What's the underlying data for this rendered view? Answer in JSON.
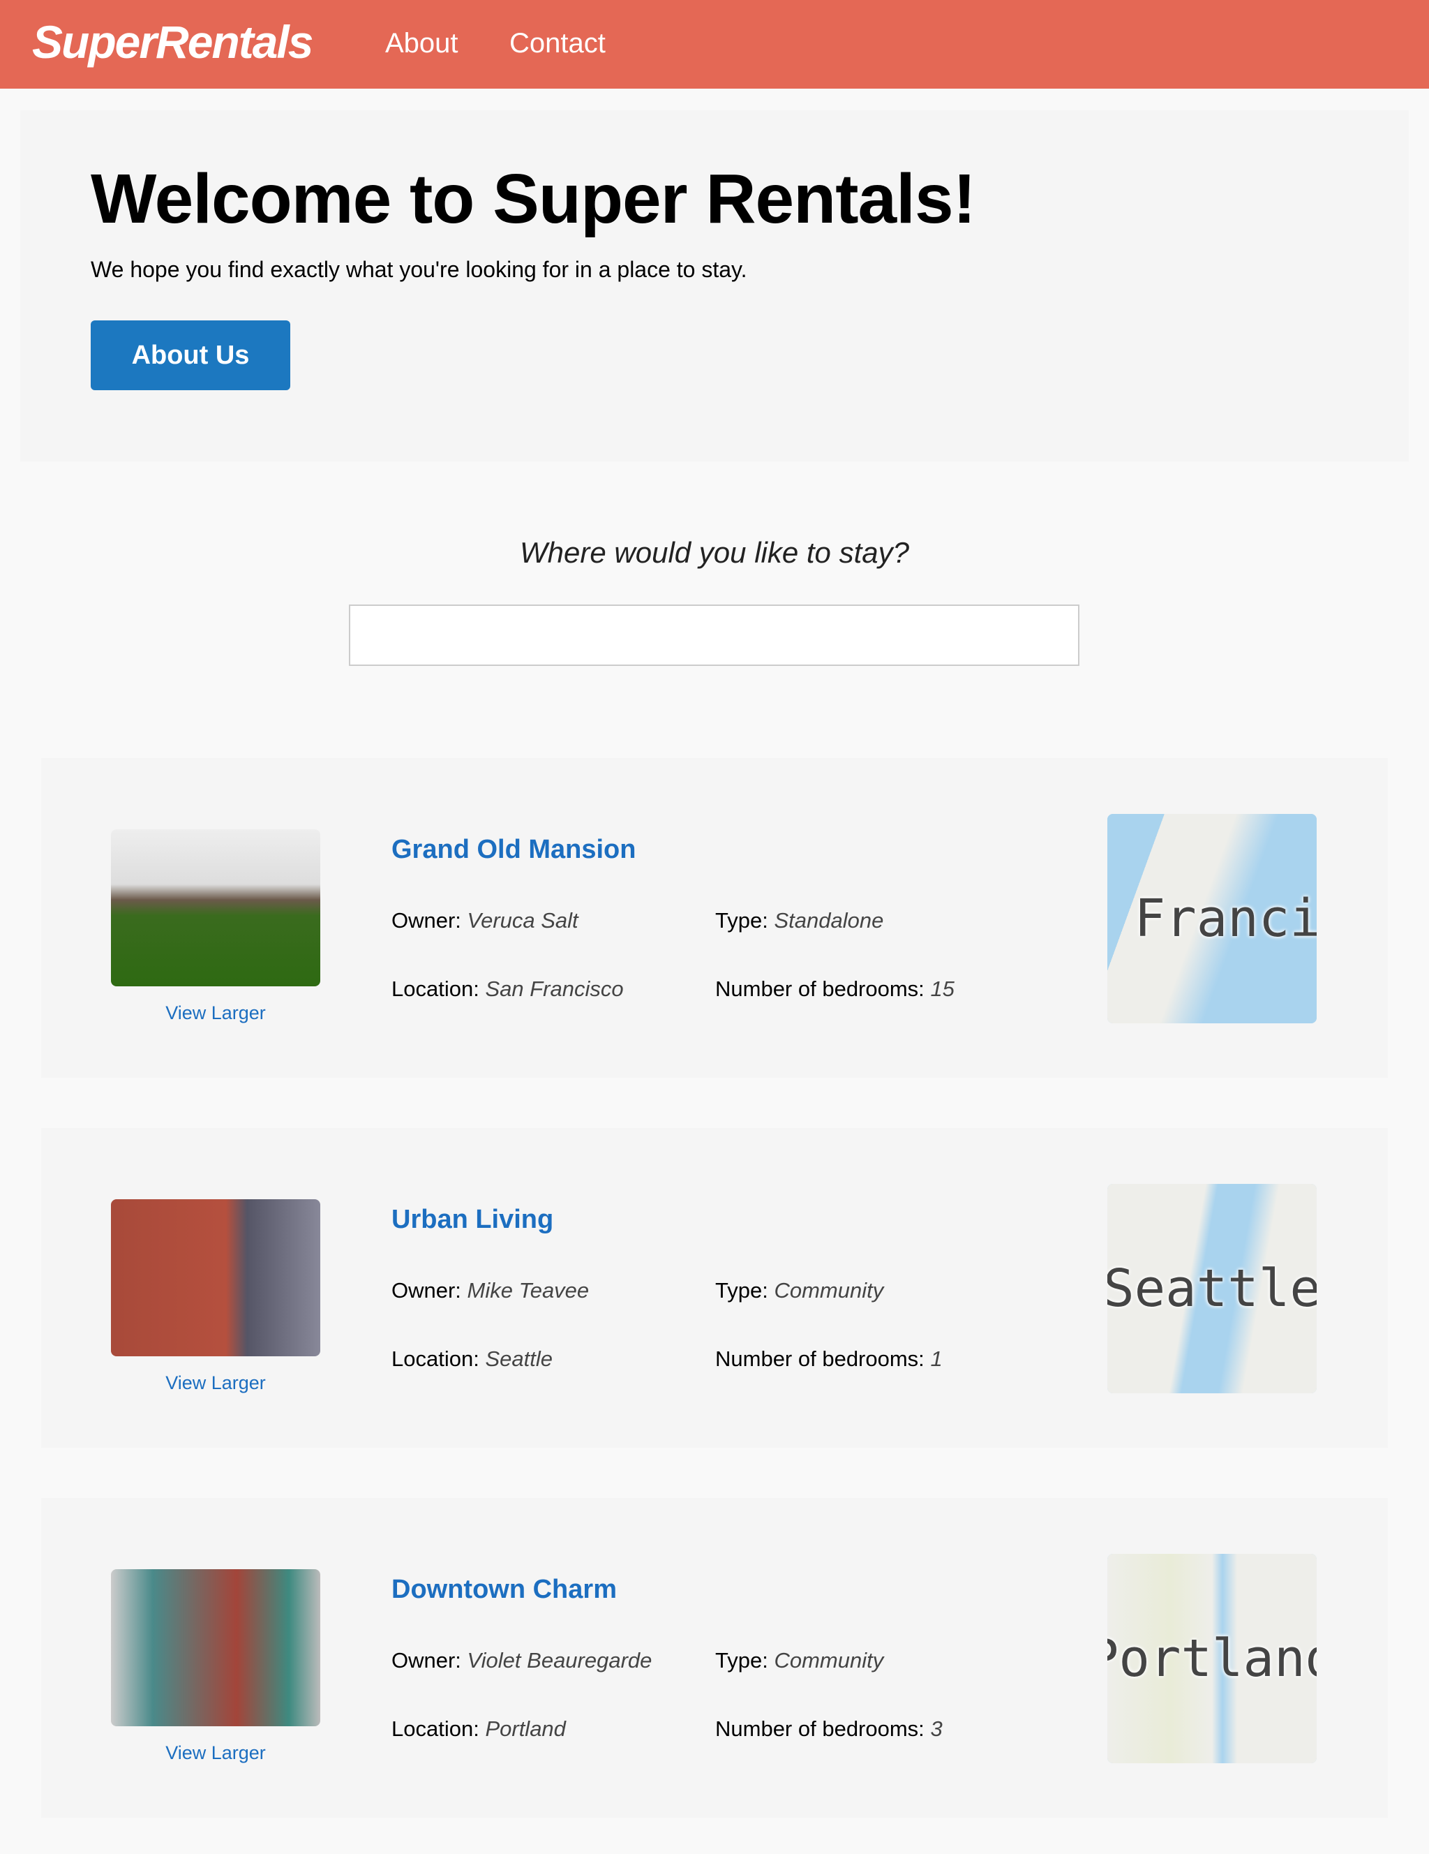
{
  "header": {
    "logo": "SuperRentals",
    "nav": [
      "About",
      "Contact"
    ]
  },
  "jumbo": {
    "title": "Welcome to Super Rentals!",
    "subtitle": "We hope you find exactly what you're looking for in a place to stay.",
    "button": "About Us"
  },
  "search": {
    "prompt": "Where would you like to stay?",
    "value": ""
  },
  "labels": {
    "owner": "Owner:",
    "type": "Type:",
    "location": "Location:",
    "bedrooms": "Number of bedrooms:",
    "view_larger": "View Larger"
  },
  "rentals": [
    {
      "title": "Grand Old Mansion",
      "owner": "Veruca Salt",
      "type": "Standalone",
      "location": "San Francisco",
      "bedrooms": "15",
      "map_label": "n Francis"
    },
    {
      "title": "Urban Living",
      "owner": "Mike Teavee",
      "type": "Community",
      "location": "Seattle",
      "bedrooms": "1",
      "map_label": "Seattle"
    },
    {
      "title": "Downtown Charm",
      "owner": "Violet Beauregarde",
      "type": "Community",
      "location": "Portland",
      "bedrooms": "3",
      "map_label": "Portland"
    }
  ],
  "colors": {
    "header": "#e46855",
    "accent": "#1c78c0",
    "link": "#1c6ec0"
  }
}
